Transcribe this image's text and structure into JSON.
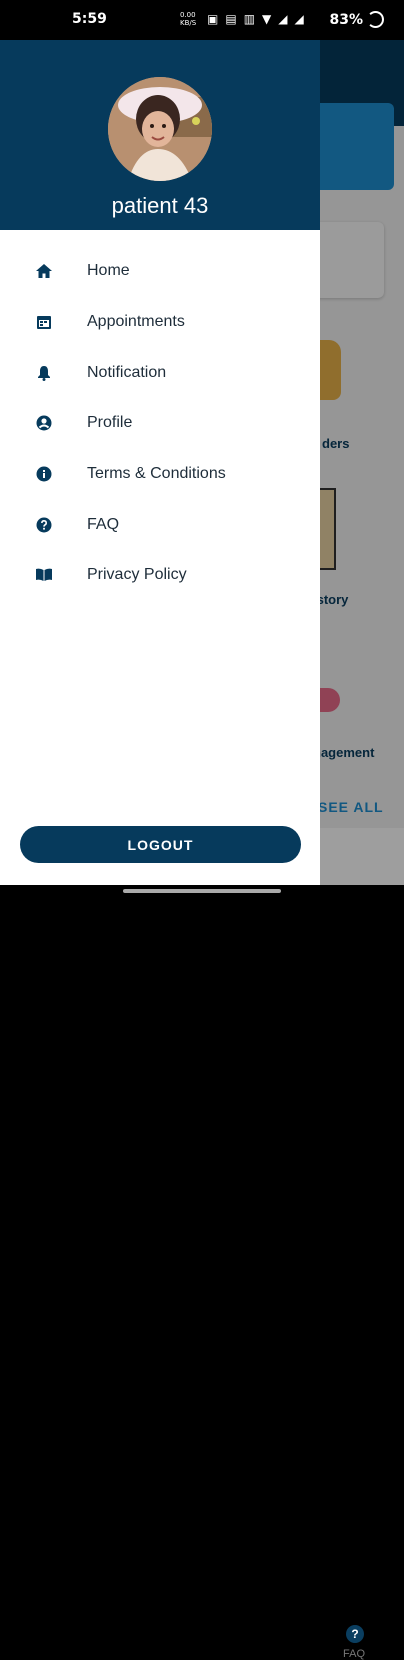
{
  "status_bar": {
    "time": "5:59",
    "speed": "0.00 KB/S",
    "battery": "83%"
  },
  "drawer": {
    "patient_name": "patient 43",
    "menu": [
      {
        "label": "Home",
        "icon": "home-icon"
      },
      {
        "label": "Appointments",
        "icon": "calendar-icon"
      },
      {
        "label": "Notification",
        "icon": "bell-icon"
      },
      {
        "label": "Profile",
        "icon": "account-circle-icon"
      },
      {
        "label": "Terms & Conditions",
        "icon": "info-icon"
      },
      {
        "label": "FAQ",
        "icon": "help-icon"
      },
      {
        "label": "Privacy Policy",
        "icon": "book-icon"
      }
    ],
    "logout_label": "LOGOUT"
  },
  "background": {
    "text1": "ders",
    "text2": "istory",
    "text3": "nagement",
    "see_all": "SEE ALL",
    "tab_faq": "FAQ"
  },
  "colors": {
    "primary": "#063a5c",
    "accent": "#1e8fd1"
  }
}
